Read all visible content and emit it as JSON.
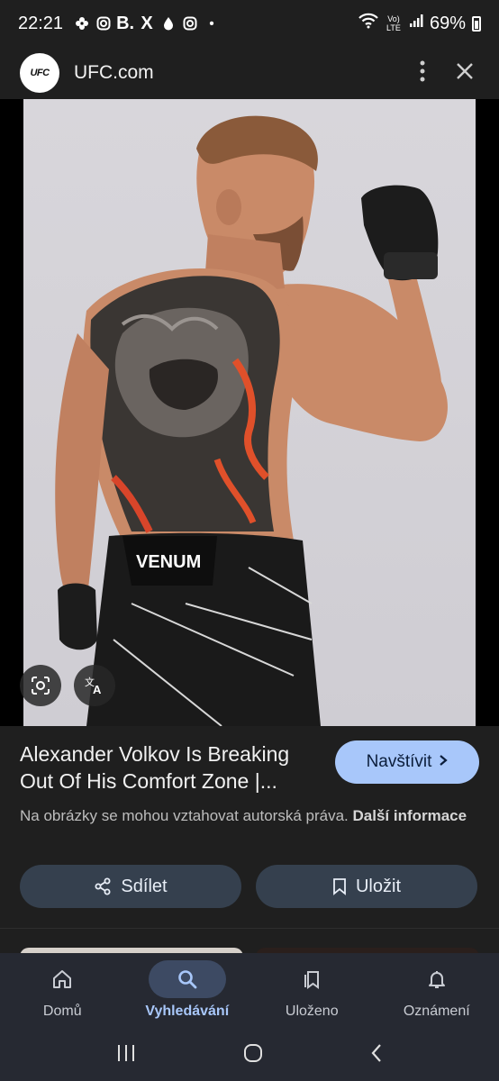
{
  "status_bar": {
    "time": "22:21",
    "notification_icons": [
      "pinwheel-icon",
      "instagram-icon",
      "b-icon",
      "x-icon",
      "drop-icon",
      "instagram-icon",
      "dot-icon"
    ],
    "b_letter": "B.",
    "x_letter": "X",
    "dot": "•",
    "network_label": "Vo) LTE",
    "battery": "69%"
  },
  "header": {
    "logo_text": "UFC",
    "site_name": "UFC.com"
  },
  "image": {
    "subject": "photo-fighter-back-tattoo",
    "shorts_brand": "VENUM"
  },
  "result": {
    "title": "Alexander Volkov Is Breaking Out Of His Comfort Zone |...",
    "visit_label": "Navštívit",
    "copyright_text": "Na obrázky se mohou vztahovat autorská práva.",
    "more_info": "Další informace",
    "share_label": "Sdílet",
    "save_label": "Uložit"
  },
  "bottom_nav": {
    "items": [
      {
        "label": "Domů",
        "icon": "home-icon",
        "active": false
      },
      {
        "label": "Vyhledávání",
        "icon": "search-icon",
        "active": true
      },
      {
        "label": "Uloženo",
        "icon": "saved-icon",
        "active": false
      },
      {
        "label": "Oznámení",
        "icon": "bell-icon",
        "active": false
      }
    ]
  },
  "colors": {
    "background": "#1f1f1f",
    "accent": "#a8c7fa",
    "pill": "#35404e",
    "nav": "#262932"
  }
}
